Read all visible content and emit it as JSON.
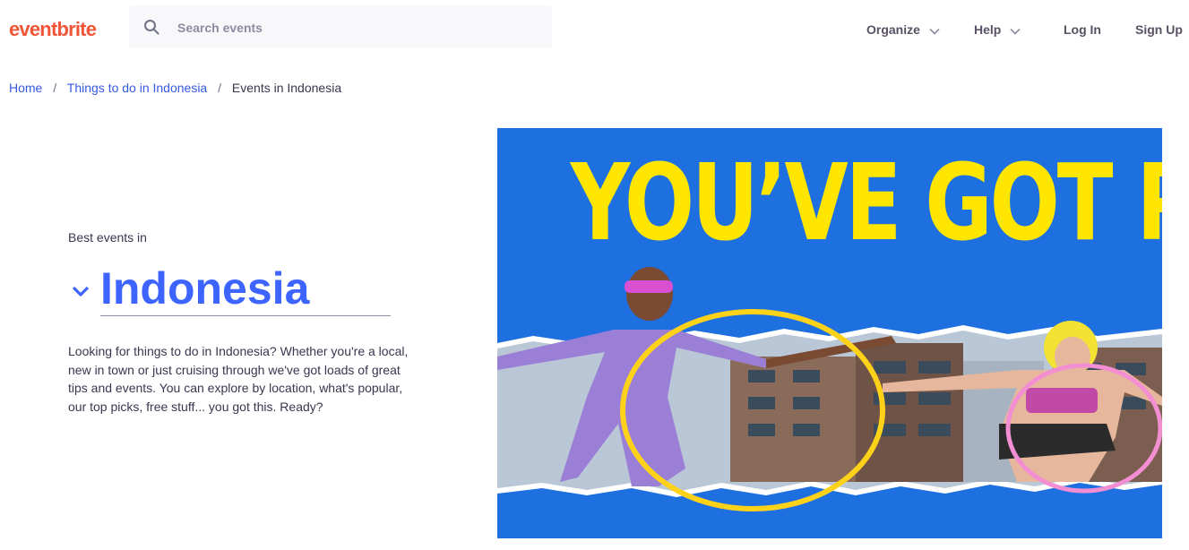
{
  "header": {
    "logo": "eventbrite",
    "search_placeholder": "Search events",
    "nav": {
      "organize": "Organize",
      "help": "Help",
      "login": "Log In",
      "signup": "Sign Up"
    }
  },
  "breadcrumb": {
    "home": "Home",
    "things": "Things to do in Indonesia",
    "current": "Events in Indonesia",
    "separator": "/"
  },
  "hero": {
    "kicker": "Best events in",
    "location": "Indonesia",
    "description": "Looking for things to do in Indonesia? Whether you're a local, new in town or just cruising through we've got loads of great tips and events. You can explore by location, what's popular, our top picks, free stuff... you got this. Ready?",
    "image_headline": "YOU’VE GOT PLANS"
  },
  "colors": {
    "brand": "#f05537",
    "link": "#3659e3",
    "location": "#3d64ff",
    "hero_bg": "#1e6fe0",
    "hero_text": "#ffe600"
  },
  "icons": [
    "search-icon",
    "chevron-down-icon",
    "location-dropdown-icon"
  ]
}
